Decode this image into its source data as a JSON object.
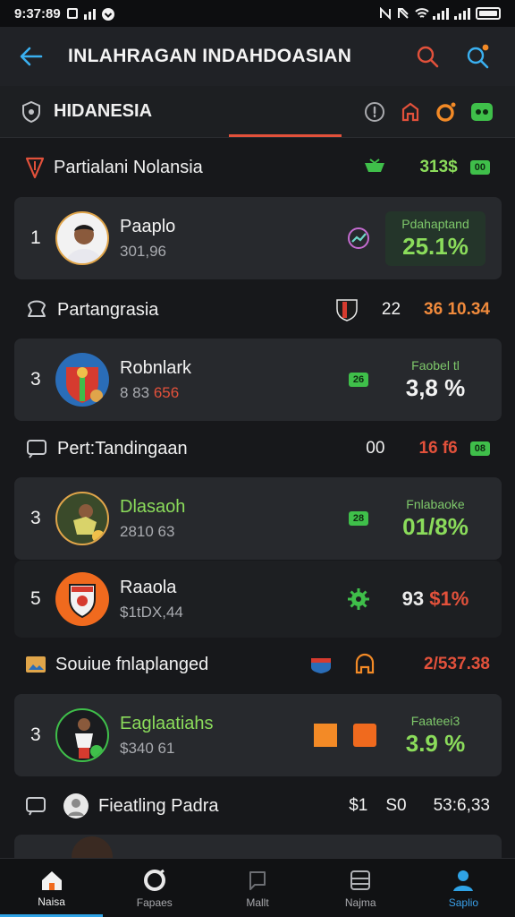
{
  "status_bar": {
    "time": "9:37:89",
    "signal_label": "ıl"
  },
  "app_bar": {
    "title": "INLAHRAGAN INDAHDOASIAN",
    "back_icon": "back-arrow-icon",
    "actions": [
      "search-icon",
      "search-notification-icon"
    ]
  },
  "filter_bar": {
    "label": "HIDANESIA",
    "icons": [
      "shield-icon",
      "info-icon",
      "red-icon",
      "orange-icon",
      "green-icon"
    ]
  },
  "sections": [
    {
      "title": "Partialani Nolansia",
      "value": "313$",
      "badge": "00"
    },
    {
      "title": "Partangrasia",
      "value_1": "22",
      "value_2": "36 10.34"
    },
    {
      "title": "Pert:Tandingaan",
      "value_1": "00",
      "value_2": "16 f6",
      "badge": "08"
    },
    {
      "title": "Souiue fnlaplanged",
      "value": "2/537.38"
    },
    {
      "title": "Fieatling Padra",
      "value_1": "$1",
      "value_2": "S0",
      "value_3": "53:6,33"
    }
  ],
  "cards": [
    {
      "rank": "1",
      "name": "Paaplo",
      "sub": "301,96",
      "stat_label": "Pdahaptand",
      "stat_value": "25.1%"
    },
    {
      "rank": "3",
      "name": "Robnlark",
      "sub_1": "8 83",
      "sub_2": "656",
      "badge": "26",
      "stat_label": "Faobel tl",
      "stat_value": "3,8 %"
    },
    {
      "rank": "3",
      "name": "Dlasaoh",
      "sub": "2810 63",
      "badge": "28",
      "stat_label": "Fnlabaoke",
      "stat_value": "01/8%"
    },
    {
      "rank": "5",
      "name": "Raaola",
      "sub": "$1tDX,44",
      "stat_value_1": "93",
      "stat_value_2": "$1%"
    },
    {
      "rank": "3",
      "name": "Eaglaatiahs",
      "sub": "$340 61",
      "stat_label": "Faateei3",
      "stat_value": "3.9 %"
    }
  ],
  "bottom_nav": [
    {
      "label": "Naisa",
      "icon": "home-icon"
    },
    {
      "label": "Fapaes",
      "icon": "ring-icon"
    },
    {
      "label": "Mallt",
      "icon": "chat-icon"
    },
    {
      "label": "Najma",
      "icon": "grid-icon"
    },
    {
      "label": "Saplio",
      "icon": "profile-icon"
    }
  ],
  "colors": {
    "green": "#8bdc5b",
    "red": "#e2513b",
    "orange": "#f38a26",
    "blue": "#2fa3e6"
  }
}
